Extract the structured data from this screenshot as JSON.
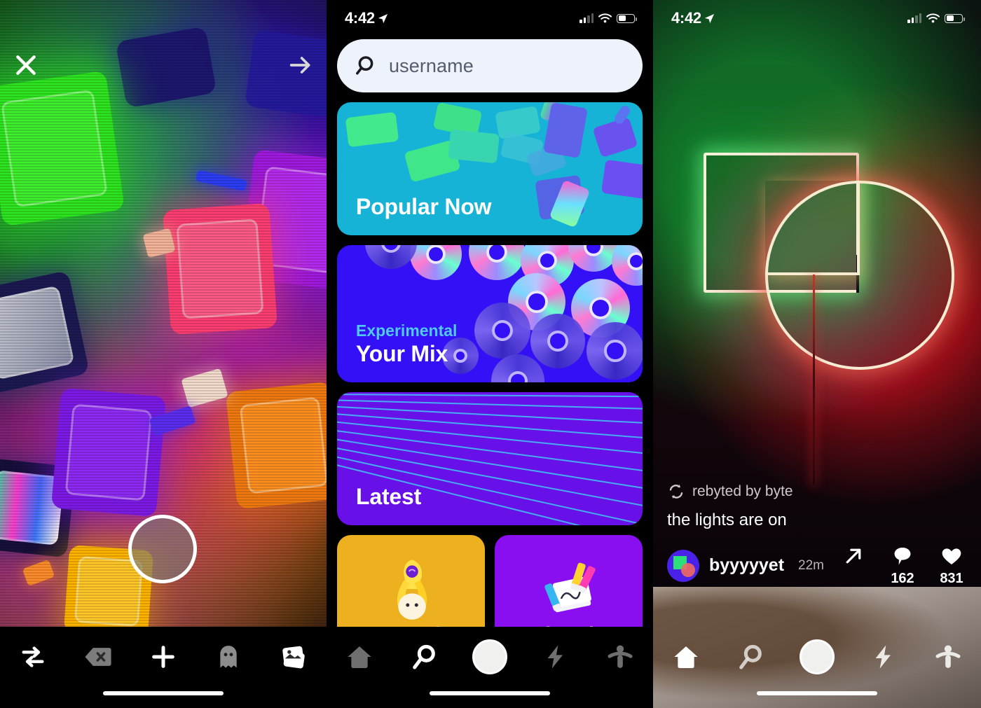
{
  "status_bar": {
    "time": "4:42",
    "location_icon": "location-arrow-icon",
    "signal_icon": "cellular-signal-icon",
    "wifi_icon": "wifi-icon",
    "battery_icon": "battery-icon"
  },
  "camera_screen": {
    "name": "byte-camera-screen",
    "close_icon": "close-x-icon",
    "next_icon": "arrow-right-icon",
    "shutter": "camera-shutter-button",
    "nav": [
      {
        "name": "flip-camera",
        "icon": "swap-arrows-icon",
        "active": false
      },
      {
        "name": "delete-clip",
        "icon": "backspace-delete-icon",
        "active": false
      },
      {
        "name": "add-clip",
        "icon": "plus-icon",
        "active": false
      },
      {
        "name": "ghost-overlay",
        "icon": "ghost-icon",
        "active": false
      },
      {
        "name": "photo-library",
        "icon": "photo-stack-icon",
        "active": false
      }
    ]
  },
  "explore_screen": {
    "name": "byte-explore-screen",
    "search": {
      "placeholder": "username",
      "value": "",
      "icon": "search-magnifier-icon"
    },
    "cards": [
      {
        "title": "Popular Now",
        "subtitle": "",
        "color": "#17b3d6",
        "art": "floating-phones"
      },
      {
        "title": "Your Mix",
        "subtitle": "Experimental",
        "color": "#3310f5",
        "art": "cd-discs"
      },
      {
        "title": "Latest",
        "subtitle": "",
        "color": "#6810e8",
        "art": "radiating-lines"
      }
    ],
    "category_cards": [
      {
        "title": "Comedy",
        "color": "#edb01f",
        "art": "banana-character"
      },
      {
        "title": "Animation",
        "color": "#8a0ff0",
        "art": "markers-paper"
      }
    ],
    "nav": [
      {
        "name": "home",
        "icon": "home-icon",
        "active": false
      },
      {
        "name": "explore",
        "icon": "search-magnifier-icon",
        "active": true
      },
      {
        "name": "camera",
        "icon": "shutter-circle-icon",
        "active": false
      },
      {
        "name": "activity",
        "icon": "lightning-bolt-icon",
        "active": false
      },
      {
        "name": "profile",
        "icon": "person-icon",
        "active": false
      }
    ]
  },
  "feed_screen": {
    "name": "byte-feed-screen",
    "rebyte": {
      "label": "rebyted by byte",
      "icon": "rebyte-loop-icon"
    },
    "caption": "the lights are on",
    "user": {
      "username": "byyyyyet",
      "time": "22m",
      "avatar": "byte-logo-avatar"
    },
    "actions": [
      {
        "name": "share",
        "icon": "share-arrow-icon",
        "count": ""
      },
      {
        "name": "comments",
        "icon": "comment-bubble-icon",
        "count": "162"
      },
      {
        "name": "likes",
        "icon": "heart-icon",
        "count": "831"
      }
    ],
    "nav": [
      {
        "name": "home",
        "icon": "home-icon",
        "active": true
      },
      {
        "name": "explore",
        "icon": "search-magnifier-icon",
        "active": false
      },
      {
        "name": "camera",
        "icon": "shutter-circle-icon",
        "active": false
      },
      {
        "name": "activity",
        "icon": "lightning-bolt-icon",
        "active": false
      },
      {
        "name": "profile",
        "icon": "person-icon",
        "active": false
      }
    ]
  }
}
